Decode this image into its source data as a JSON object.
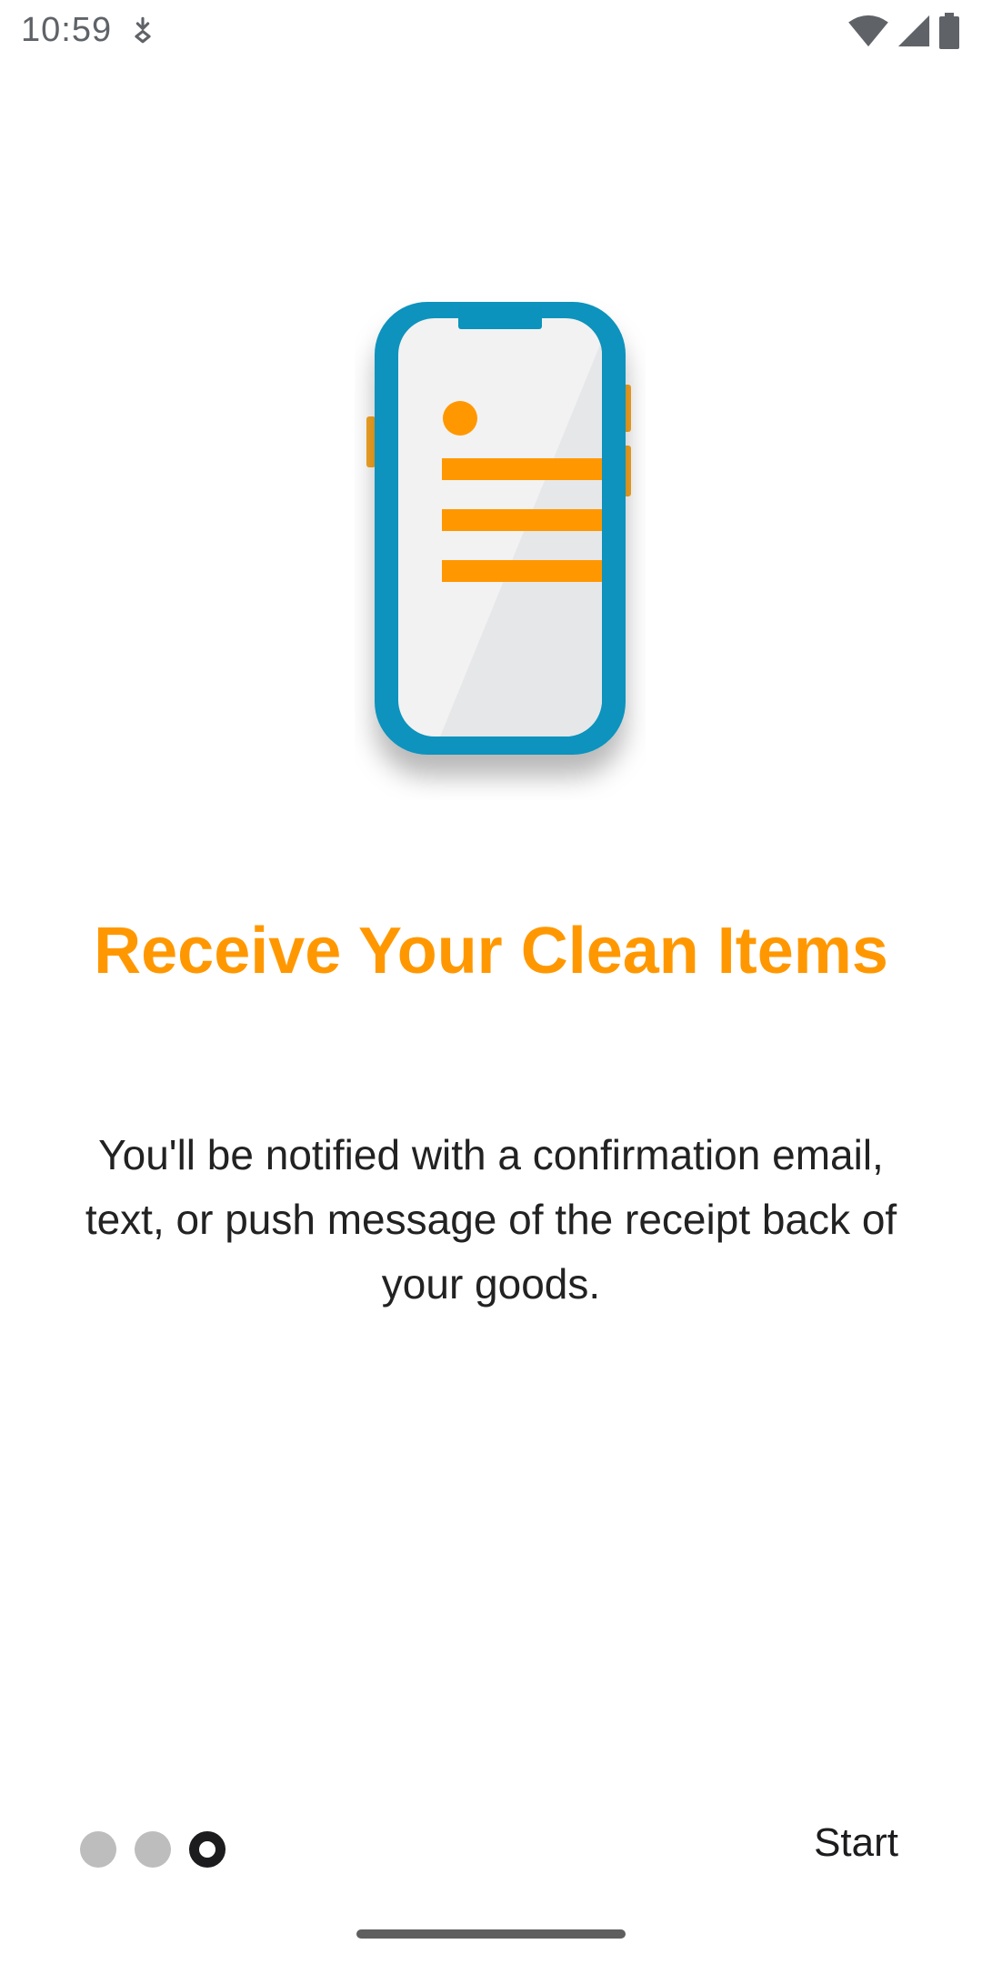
{
  "status_bar": {
    "time": "10:59",
    "icons": [
      "debug-icon",
      "wifi-icon",
      "cell-signal-icon",
      "battery-icon"
    ]
  },
  "onboarding": {
    "illustration": "phone-notification-illustration",
    "title": "Receive Your Clean Items",
    "description": "You'll be notified with a confirmation email, text, or push message of the receipt back of your goods.",
    "pager": {
      "total": 3,
      "current": 3
    },
    "start_label": "Start"
  },
  "colors": {
    "accent": "#ff9800",
    "phone_frame": "#0b93bd",
    "text_dark": "#222222",
    "dot_inactive": "#bdbdbd",
    "dot_active": "#1c1c1e"
  }
}
